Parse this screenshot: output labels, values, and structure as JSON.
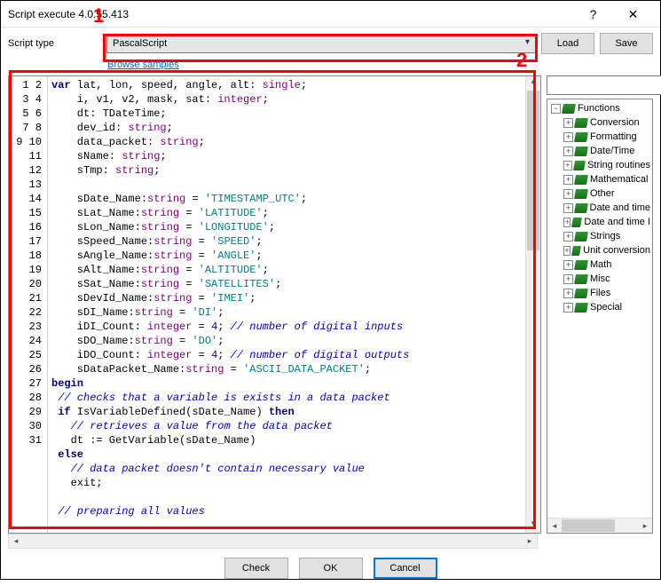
{
  "window": {
    "title": "Script execute 4.0.55.413"
  },
  "top": {
    "label": "Script type",
    "combo_value": "PascalScript",
    "load": "Load",
    "save": "Save",
    "browse": "Browse samples"
  },
  "annotations": {
    "a1": "1",
    "a2": "2"
  },
  "code_lines": [
    {
      "n": 1,
      "seg": [
        {
          "c": "kw",
          "t": "var"
        },
        {
          "t": " lat, lon, speed, angle, alt: "
        },
        {
          "c": "ty",
          "t": "single"
        },
        {
          "t": ";"
        }
      ]
    },
    {
      "n": 2,
      "seg": [
        {
          "t": "    i, v1, v2, mask, sat: "
        },
        {
          "c": "ty",
          "t": "integer"
        },
        {
          "t": ";"
        }
      ]
    },
    {
      "n": 3,
      "seg": [
        {
          "t": "    dt: TDateTime;"
        }
      ]
    },
    {
      "n": 4,
      "seg": [
        {
          "t": "    dev_id: "
        },
        {
          "c": "ty",
          "t": "string"
        },
        {
          "t": ";"
        }
      ]
    },
    {
      "n": 5,
      "seg": [
        {
          "t": "    data_packet: "
        },
        {
          "c": "ty",
          "t": "string"
        },
        {
          "t": ";"
        }
      ]
    },
    {
      "n": 6,
      "seg": [
        {
          "t": "    sName: "
        },
        {
          "c": "ty",
          "t": "string"
        },
        {
          "t": ";"
        }
      ]
    },
    {
      "n": 7,
      "seg": [
        {
          "t": "    sTmp: "
        },
        {
          "c": "ty",
          "t": "string"
        },
        {
          "t": ";"
        }
      ]
    },
    {
      "n": 8,
      "seg": [
        {
          "t": ""
        }
      ]
    },
    {
      "n": 9,
      "seg": [
        {
          "t": "    sDate_Name:"
        },
        {
          "c": "ty",
          "t": "string"
        },
        {
          "t": " = "
        },
        {
          "c": "str",
          "t": "'TIMESTAMP_UTC'"
        },
        {
          "t": ";"
        }
      ]
    },
    {
      "n": 10,
      "seg": [
        {
          "t": "    sLat_Name:"
        },
        {
          "c": "ty",
          "t": "string"
        },
        {
          "t": " = "
        },
        {
          "c": "str",
          "t": "'LATITUDE'"
        },
        {
          "t": ";"
        }
      ]
    },
    {
      "n": 11,
      "seg": [
        {
          "t": "    sLon_Name:"
        },
        {
          "c": "ty",
          "t": "string"
        },
        {
          "t": " = "
        },
        {
          "c": "str",
          "t": "'LONGITUDE'"
        },
        {
          "t": ";"
        }
      ]
    },
    {
      "n": 12,
      "seg": [
        {
          "t": "    sSpeed_Name:"
        },
        {
          "c": "ty",
          "t": "string"
        },
        {
          "t": " = "
        },
        {
          "c": "str",
          "t": "'SPEED'"
        },
        {
          "t": ";"
        }
      ]
    },
    {
      "n": 13,
      "seg": [
        {
          "t": "    sAngle_Name:"
        },
        {
          "c": "ty",
          "t": "string"
        },
        {
          "t": " = "
        },
        {
          "c": "str",
          "t": "'ANGLE'"
        },
        {
          "t": ";"
        }
      ]
    },
    {
      "n": 14,
      "seg": [
        {
          "t": "    sAlt_Name:"
        },
        {
          "c": "ty",
          "t": "string"
        },
        {
          "t": " = "
        },
        {
          "c": "str",
          "t": "'ALTITUDE'"
        },
        {
          "t": ";"
        }
      ]
    },
    {
      "n": 15,
      "seg": [
        {
          "t": "    sSat_Name:"
        },
        {
          "c": "ty",
          "t": "string"
        },
        {
          "t": " = "
        },
        {
          "c": "str",
          "t": "'SATELLITES'"
        },
        {
          "t": ";"
        }
      ]
    },
    {
      "n": 16,
      "seg": [
        {
          "t": "    sDevId_Name:"
        },
        {
          "c": "ty",
          "t": "string"
        },
        {
          "t": " = "
        },
        {
          "c": "str",
          "t": "'IMEI'"
        },
        {
          "t": ";"
        }
      ]
    },
    {
      "n": 17,
      "seg": [
        {
          "t": "    sDI_Name:"
        },
        {
          "c": "ty",
          "t": "string"
        },
        {
          "t": " = "
        },
        {
          "c": "str",
          "t": "'DI'"
        },
        {
          "t": ";"
        }
      ]
    },
    {
      "n": 18,
      "seg": [
        {
          "t": "    iDI_Count: "
        },
        {
          "c": "ty",
          "t": "integer"
        },
        {
          "t": " = "
        },
        {
          "c": "num",
          "t": "4"
        },
        {
          "t": "; "
        },
        {
          "c": "cm",
          "t": "// number of digital inputs"
        }
      ]
    },
    {
      "n": 19,
      "seg": [
        {
          "t": "    sDO_Name:"
        },
        {
          "c": "ty",
          "t": "string"
        },
        {
          "t": " = "
        },
        {
          "c": "str",
          "t": "'DO'"
        },
        {
          "t": ";"
        }
      ]
    },
    {
      "n": 20,
      "seg": [
        {
          "t": "    iDO_Count: "
        },
        {
          "c": "ty",
          "t": "integer"
        },
        {
          "t": " = "
        },
        {
          "c": "num",
          "t": "4"
        },
        {
          "t": "; "
        },
        {
          "c": "cm",
          "t": "// number of digital outputs"
        }
      ]
    },
    {
      "n": 21,
      "seg": [
        {
          "t": "    sDataPacket_Name:"
        },
        {
          "c": "ty",
          "t": "string"
        },
        {
          "t": " = "
        },
        {
          "c": "str",
          "t": "'ASCII_DATA_PACKET'"
        },
        {
          "t": ";"
        }
      ]
    },
    {
      "n": 22,
      "seg": [
        {
          "c": "kw",
          "t": "begin"
        }
      ]
    },
    {
      "n": 23,
      "seg": [
        {
          "t": " "
        },
        {
          "c": "cm",
          "t": "// checks that a variable is exists in a data packet"
        }
      ]
    },
    {
      "n": 24,
      "seg": [
        {
          "t": " "
        },
        {
          "c": "kw",
          "t": "if"
        },
        {
          "t": " IsVariableDefined(sDate_Name) "
        },
        {
          "c": "kw",
          "t": "then"
        }
      ]
    },
    {
      "n": 25,
      "seg": [
        {
          "t": "   "
        },
        {
          "c": "cm",
          "t": "// retrieves a value from the data packet"
        }
      ]
    },
    {
      "n": 26,
      "seg": [
        {
          "t": "   dt := GetVariable(sDate_Name)"
        }
      ]
    },
    {
      "n": 27,
      "seg": [
        {
          "t": " "
        },
        {
          "c": "kw",
          "t": "else"
        }
      ]
    },
    {
      "n": 28,
      "seg": [
        {
          "t": "   "
        },
        {
          "c": "cm",
          "t": "// data packet doesn't contain necessary value"
        }
      ]
    },
    {
      "n": 29,
      "seg": [
        {
          "t": "   exit;"
        }
      ]
    },
    {
      "n": 30,
      "seg": [
        {
          "t": ""
        }
      ]
    },
    {
      "n": 31,
      "seg": [
        {
          "t": " "
        },
        {
          "c": "cm",
          "t": "// preparing all values"
        }
      ]
    }
  ],
  "tree": {
    "root": "Functions",
    "items": [
      "Conversion",
      "Formatting",
      "Date/Time",
      "String routines",
      "Mathematical",
      "Other",
      "Date and time",
      "Date and time I",
      "Strings",
      "Unit conversion",
      "Math",
      "Misc",
      "Files",
      "Special"
    ]
  },
  "buttons": {
    "check": "Check",
    "ok": "OK",
    "cancel": "Cancel"
  },
  "search": {
    "placeholder": ""
  }
}
